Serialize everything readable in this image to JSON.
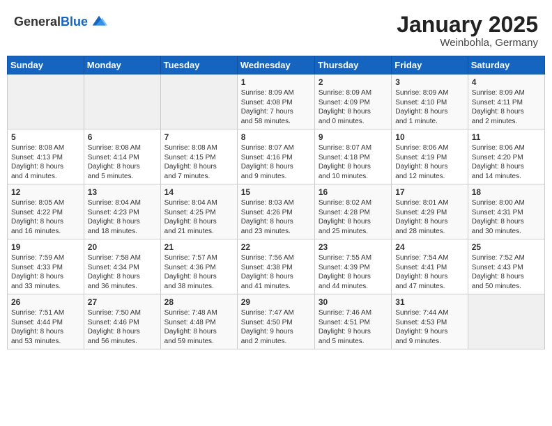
{
  "header": {
    "logo_general": "General",
    "logo_blue": "Blue",
    "month_year": "January 2025",
    "location": "Weinbohla, Germany"
  },
  "weekdays": [
    "Sunday",
    "Monday",
    "Tuesday",
    "Wednesday",
    "Thursday",
    "Friday",
    "Saturday"
  ],
  "weeks": [
    [
      {
        "day": "",
        "info": ""
      },
      {
        "day": "",
        "info": ""
      },
      {
        "day": "",
        "info": ""
      },
      {
        "day": "1",
        "info": "Sunrise: 8:09 AM\nSunset: 4:08 PM\nDaylight: 7 hours\nand 58 minutes."
      },
      {
        "day": "2",
        "info": "Sunrise: 8:09 AM\nSunset: 4:09 PM\nDaylight: 8 hours\nand 0 minutes."
      },
      {
        "day": "3",
        "info": "Sunrise: 8:09 AM\nSunset: 4:10 PM\nDaylight: 8 hours\nand 1 minute."
      },
      {
        "day": "4",
        "info": "Sunrise: 8:09 AM\nSunset: 4:11 PM\nDaylight: 8 hours\nand 2 minutes."
      }
    ],
    [
      {
        "day": "5",
        "info": "Sunrise: 8:08 AM\nSunset: 4:13 PM\nDaylight: 8 hours\nand 4 minutes."
      },
      {
        "day": "6",
        "info": "Sunrise: 8:08 AM\nSunset: 4:14 PM\nDaylight: 8 hours\nand 5 minutes."
      },
      {
        "day": "7",
        "info": "Sunrise: 8:08 AM\nSunset: 4:15 PM\nDaylight: 8 hours\nand 7 minutes."
      },
      {
        "day": "8",
        "info": "Sunrise: 8:07 AM\nSunset: 4:16 PM\nDaylight: 8 hours\nand 9 minutes."
      },
      {
        "day": "9",
        "info": "Sunrise: 8:07 AM\nSunset: 4:18 PM\nDaylight: 8 hours\nand 10 minutes."
      },
      {
        "day": "10",
        "info": "Sunrise: 8:06 AM\nSunset: 4:19 PM\nDaylight: 8 hours\nand 12 minutes."
      },
      {
        "day": "11",
        "info": "Sunrise: 8:06 AM\nSunset: 4:20 PM\nDaylight: 8 hours\nand 14 minutes."
      }
    ],
    [
      {
        "day": "12",
        "info": "Sunrise: 8:05 AM\nSunset: 4:22 PM\nDaylight: 8 hours\nand 16 minutes."
      },
      {
        "day": "13",
        "info": "Sunrise: 8:04 AM\nSunset: 4:23 PM\nDaylight: 8 hours\nand 18 minutes."
      },
      {
        "day": "14",
        "info": "Sunrise: 8:04 AM\nSunset: 4:25 PM\nDaylight: 8 hours\nand 21 minutes."
      },
      {
        "day": "15",
        "info": "Sunrise: 8:03 AM\nSunset: 4:26 PM\nDaylight: 8 hours\nand 23 minutes."
      },
      {
        "day": "16",
        "info": "Sunrise: 8:02 AM\nSunset: 4:28 PM\nDaylight: 8 hours\nand 25 minutes."
      },
      {
        "day": "17",
        "info": "Sunrise: 8:01 AM\nSunset: 4:29 PM\nDaylight: 8 hours\nand 28 minutes."
      },
      {
        "day": "18",
        "info": "Sunrise: 8:00 AM\nSunset: 4:31 PM\nDaylight: 8 hours\nand 30 minutes."
      }
    ],
    [
      {
        "day": "19",
        "info": "Sunrise: 7:59 AM\nSunset: 4:33 PM\nDaylight: 8 hours\nand 33 minutes."
      },
      {
        "day": "20",
        "info": "Sunrise: 7:58 AM\nSunset: 4:34 PM\nDaylight: 8 hours\nand 36 minutes."
      },
      {
        "day": "21",
        "info": "Sunrise: 7:57 AM\nSunset: 4:36 PM\nDaylight: 8 hours\nand 38 minutes."
      },
      {
        "day": "22",
        "info": "Sunrise: 7:56 AM\nSunset: 4:38 PM\nDaylight: 8 hours\nand 41 minutes."
      },
      {
        "day": "23",
        "info": "Sunrise: 7:55 AM\nSunset: 4:39 PM\nDaylight: 8 hours\nand 44 minutes."
      },
      {
        "day": "24",
        "info": "Sunrise: 7:54 AM\nSunset: 4:41 PM\nDaylight: 8 hours\nand 47 minutes."
      },
      {
        "day": "25",
        "info": "Sunrise: 7:52 AM\nSunset: 4:43 PM\nDaylight: 8 hours\nand 50 minutes."
      }
    ],
    [
      {
        "day": "26",
        "info": "Sunrise: 7:51 AM\nSunset: 4:44 PM\nDaylight: 8 hours\nand 53 minutes."
      },
      {
        "day": "27",
        "info": "Sunrise: 7:50 AM\nSunset: 4:46 PM\nDaylight: 8 hours\nand 56 minutes."
      },
      {
        "day": "28",
        "info": "Sunrise: 7:48 AM\nSunset: 4:48 PM\nDaylight: 8 hours\nand 59 minutes."
      },
      {
        "day": "29",
        "info": "Sunrise: 7:47 AM\nSunset: 4:50 PM\nDaylight: 9 hours\nand 2 minutes."
      },
      {
        "day": "30",
        "info": "Sunrise: 7:46 AM\nSunset: 4:51 PM\nDaylight: 9 hours\nand 5 minutes."
      },
      {
        "day": "31",
        "info": "Sunrise: 7:44 AM\nSunset: 4:53 PM\nDaylight: 9 hours\nand 9 minutes."
      },
      {
        "day": "",
        "info": ""
      }
    ]
  ]
}
